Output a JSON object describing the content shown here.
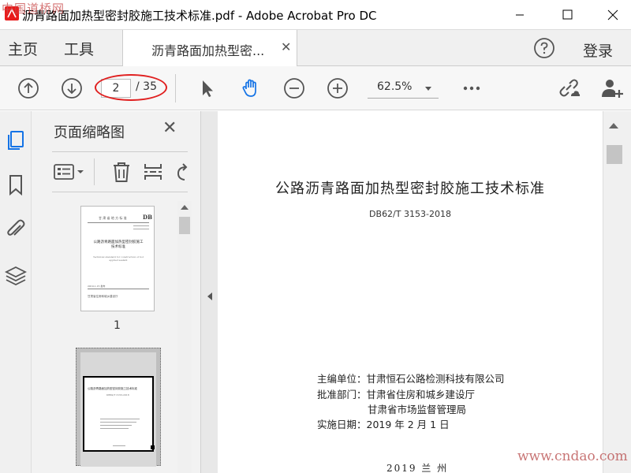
{
  "window": {
    "title": "沥青路面加热型密封胶施工技术标准.pdf - Adobe Acrobat Pro DC",
    "watermark_top_left": "中国道桥网"
  },
  "tabs": {
    "home": "主页",
    "tools": "工具",
    "document_tab": "沥青路面加热型密...",
    "login": "登录"
  },
  "toolbar": {
    "current_page": "2",
    "page_total": "/ 35",
    "zoom": "62.5%"
  },
  "panel": {
    "title": "页面缩略图",
    "thumb1_number": "1"
  },
  "thumb1": {
    "header": "甘 肃 省 地 方 标 准",
    "db": "DB",
    "title": "公路沥青路面加热型密封胶施工技术标准",
    "en": "Technical standard for construction of hot applied sealant",
    "date": "2019-1-15 发布",
    "org": "甘肃省住房和城乡建设厅"
  },
  "thumb2": {
    "title": "公路沥青路面加热型密封胶施工技术标准",
    "code": "DB62/T 3153-2018"
  },
  "document": {
    "title": "公路沥青路面加热型密封胶施工技术标准",
    "code": "DB62/T 3153-2018",
    "editor": "主编单位：甘肃恒石公路检测科技有限公司",
    "approver": "批准部门：甘肃省住房和城乡建设厅",
    "approver2": "甘肃省市场监督管理局",
    "effective": "实施日期：2019 年 2 月 1 日",
    "footer": "2019   兰   州"
  },
  "watermark_bottom_right": "www.cndao.com",
  "colors": {
    "accent_blue": "#1473e6",
    "annotation_red": "#e02020",
    "acrobat_red": "#e81c1c"
  }
}
